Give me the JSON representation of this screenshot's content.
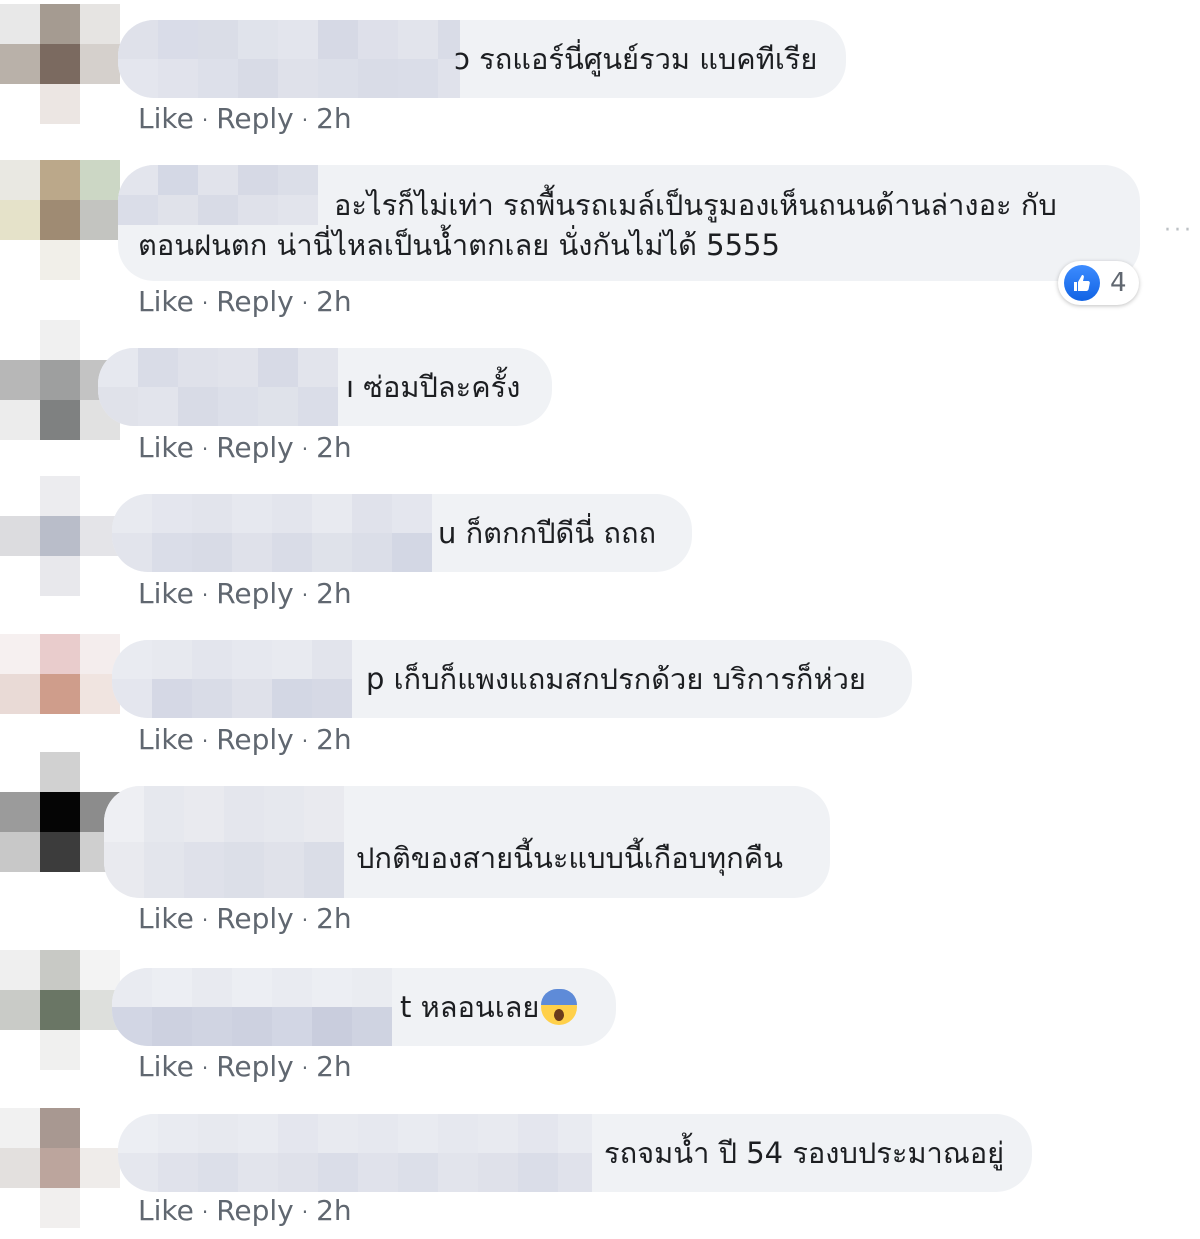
{
  "actions": {
    "like": "Like",
    "reply": "Reply",
    "dot": "·",
    "time": "2h"
  },
  "more_label": "···",
  "comments": [
    {
      "text": "ɔ รถแอร์นี่ศูนย์รวม แบคทีเรีย"
    },
    {
      "text_line1": "อะไรก็ไม่เท่า รถพื้นรถเมล์เป็นรูมองเห็นถนนด้านล่างอะ กับ",
      "text_line2": "ตอนฝนตก น่านี่ไหลเป็นน้ำตกเลย นั่งกันไม่ได้ 5555",
      "reaction_icon": "like-icon",
      "reaction_count": "4"
    },
    {
      "text": "ı ซ่อมปีละครั้ง"
    },
    {
      "text": "u ก็ตกกปีดีนี่ ถถถ"
    },
    {
      "text": "p เก็บก็แพงแถมสกปรกด้วย บริการก็ห่วย"
    },
    {
      "text": "ปกติของสายนี้นะแบบนี้เกือบทุกคืน"
    },
    {
      "text": "t หลอนเลย",
      "emoji": "face-screaming-in-fear-emoji"
    },
    {
      "text": "รถจมน้ำ ปี 54 รองบประมาณอยู่"
    }
  ]
}
